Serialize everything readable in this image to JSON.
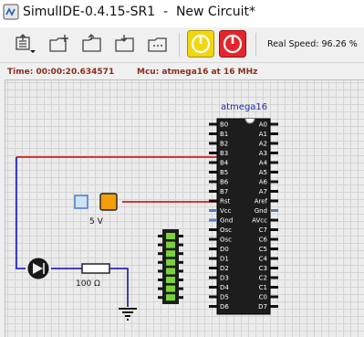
{
  "window": {
    "title": "SimulIDE-0.4.15-SR1  -  New Circuit*"
  },
  "toolbar": {
    "buttons": [
      "open-menu-icon",
      "new-circuit-icon",
      "open-icon",
      "save-icon",
      "save-as-icon"
    ],
    "power_button": {
      "color": "#f2d60f",
      "icon": "power-icon"
    },
    "stop_button": {
      "color": "#e3262d",
      "icon": "power-icon"
    },
    "speed_label": "Real Speed: 96.26 %"
  },
  "status": {
    "time": "Time: 00:00:20.634571",
    "mcu": "Mcu: atmega16 at 16 MHz"
  },
  "circuit": {
    "mcu": {
      "name": "atmega16",
      "left_pins": [
        "B0",
        "B1",
        "B2",
        "B3",
        "B4",
        "B5",
        "B6",
        "B7",
        "Rst",
        "Vcc",
        "Gnd",
        "Osc",
        "Osc",
        "D0",
        "D1",
        "D2",
        "D3",
        "D4",
        "D5",
        "D6"
      ],
      "right_pins": [
        "A0",
        "A1",
        "A2",
        "A3",
        "A4",
        "A5",
        "A6",
        "A7",
        "Aref",
        "Gnd",
        "AVcc",
        "C7",
        "C6",
        "C5",
        "C4",
        "C3",
        "C2",
        "C1",
        "C0",
        "D7"
      ]
    },
    "source_label": "5 V",
    "resistor_label": "100 Ω",
    "wire_color": "#cc1f1f",
    "wire2_color": "#2a2ab8"
  }
}
